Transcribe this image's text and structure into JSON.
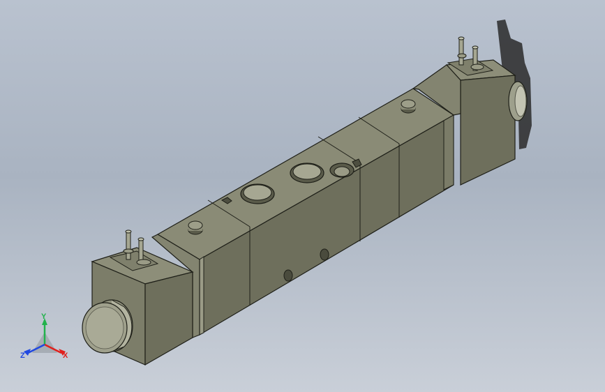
{
  "viewport": {
    "background_top": "#b9c2cf",
    "background_bottom": "#c9cfd8"
  },
  "model": {
    "part": "solenoid-valve-assembly",
    "colors": {
      "top_face": "#8a8b76",
      "front_face": "#6e6f5c",
      "end_face": "#7c7d69",
      "edge": "#1e1f18",
      "shadow": "#2a2a2a"
    }
  },
  "triad": {
    "x_label": "X",
    "y_label": "Y",
    "z_label": "Z",
    "colors": {
      "x": "#e0201c",
      "y": "#22b24c",
      "z": "#2048e0"
    }
  }
}
